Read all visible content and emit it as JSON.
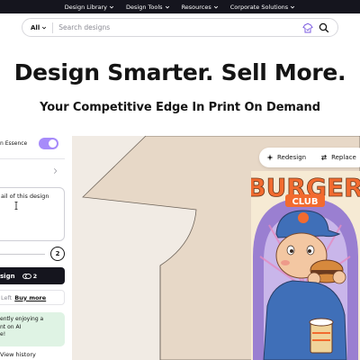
{
  "nav": {
    "items": [
      {
        "label": "Design Library"
      },
      {
        "label": "Design Tools"
      },
      {
        "label": "Resources"
      },
      {
        "label": "Corporate Solutions"
      }
    ]
  },
  "search": {
    "filter_label": "All",
    "placeholder": "Search designs",
    "value": ""
  },
  "hero": {
    "title": "Design Smarter. Sell More.",
    "subtitle": "Your Competitive Edge In Print On Demand"
  },
  "panel": {
    "essence_label": "n Essence",
    "essence_toggle_on": true,
    "prompt_text": "ail of this design",
    "count": "2",
    "design_button_label": "sign",
    "credits": "2",
    "credits_left_text": "Left",
    "buy_more_label": "Buy more",
    "promo_lines": [
      "ently enjoying a",
      "nt on AI",
      "e!"
    ],
    "history_label": "View history"
  },
  "canvas": {
    "redesign_label": "Redesign",
    "replace_label": "Replace",
    "artwork": {
      "title_top": "BURGER",
      "title_bottom": "CLUB"
    }
  },
  "colors": {
    "nav_bg": "#15151e",
    "accent_purple": "#a78bfa",
    "canvas_bg": "#f1ebe4",
    "promo_bg": "#dff3e4",
    "artwork_orange": "#f26b2f",
    "artwork_purple": "#9a7fd1"
  },
  "icons": {
    "hanger": "hanger-icon",
    "search": "search-icon",
    "redesign": "sparkle-icon",
    "replace": "swap-icon",
    "credits": "coins-icon"
  }
}
